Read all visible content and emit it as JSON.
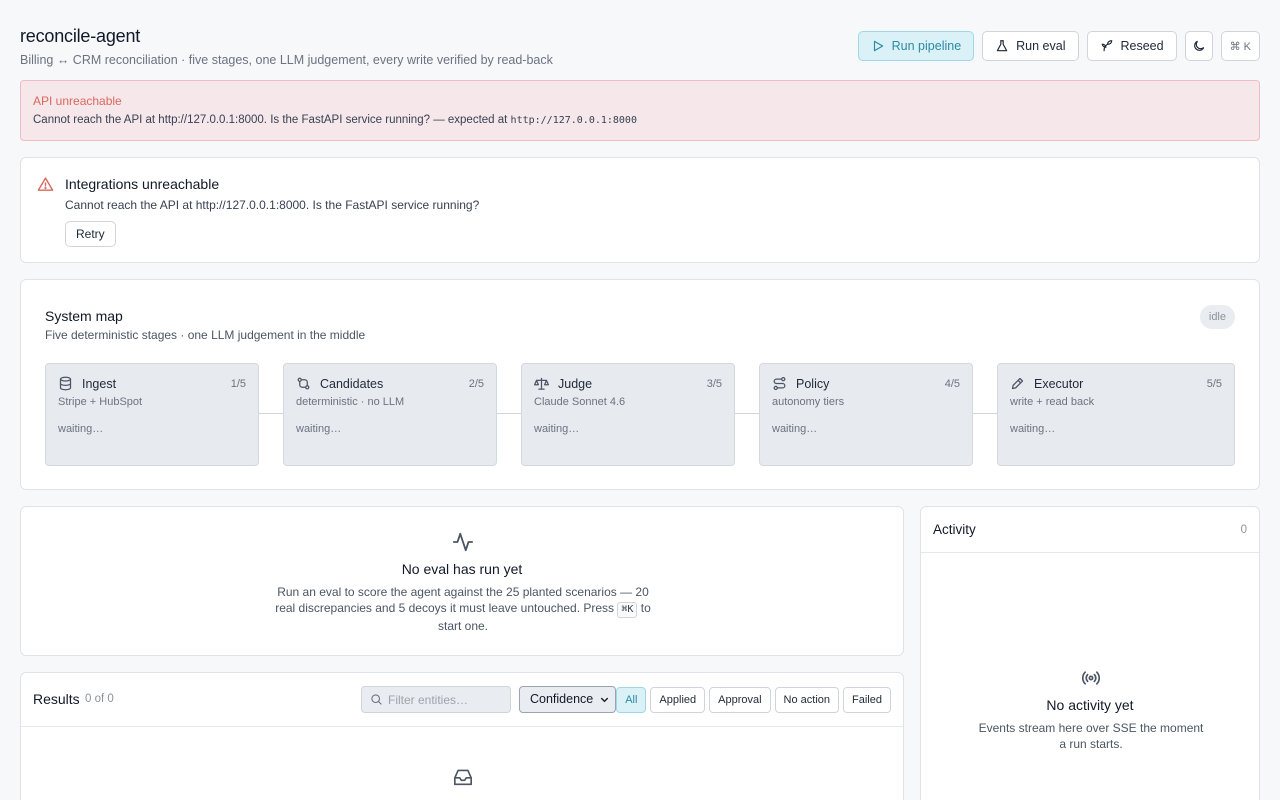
{
  "header": {
    "title": "reconcile-agent",
    "subtitle": "Billing ↔ CRM reconciliation · five stages, one LLM judgement, every write verified by read-back"
  },
  "toolbar": {
    "run_pipeline": "Run pipeline",
    "run_eval": "Run eval",
    "reseed": "Reseed",
    "kbd": "⌘ K"
  },
  "alert": {
    "title": "API unreachable",
    "message": "Cannot reach the API at http://127.0.0.1:8000. Is the FastAPI service running? — expected at ",
    "expected_url": "http://127.0.0.1:8000"
  },
  "integrations": {
    "title": "Integrations unreachable",
    "message": "Cannot reach the API at http://127.0.0.1:8000. Is the FastAPI service running?",
    "retry": "Retry"
  },
  "system_map": {
    "title": "System map",
    "subtitle": "Five deterministic stages · one LLM judgement in the middle",
    "status": "idle",
    "stages": [
      {
        "name": "Ingest",
        "step": "1/5",
        "desc": "Stripe + HubSpot",
        "status": "waiting…",
        "icon": "database-icon"
      },
      {
        "name": "Candidates",
        "step": "2/5",
        "desc": "deterministic · no LLM",
        "status": "waiting…",
        "icon": "git-compare-icon"
      },
      {
        "name": "Judge",
        "step": "3/5",
        "desc": "Claude Sonnet 4.6",
        "status": "waiting…",
        "icon": "scale-icon"
      },
      {
        "name": "Policy",
        "step": "4/5",
        "desc": "autonomy tiers",
        "status": "waiting…",
        "icon": "route-icon"
      },
      {
        "name": "Executor",
        "step": "5/5",
        "desc": "write + read back",
        "status": "waiting…",
        "icon": "pencil-icon"
      }
    ]
  },
  "eval": {
    "title": "No eval has run yet",
    "desc_before": "Run an eval to score the agent against the 25 planted scenarios — 20 real discrepancies and 5 decoys it must leave untouched. Press ",
    "kbd": "⌘K",
    "desc_after": " to start one."
  },
  "results": {
    "title": "Results",
    "count": "0 of 0",
    "search_placeholder": "Filter entities…",
    "sort": "Confidence",
    "filters": [
      "All",
      "Applied",
      "Approval",
      "No action",
      "Failed"
    ],
    "active_filter": "All"
  },
  "activity": {
    "title": "Activity",
    "count": "0",
    "empty_title": "No activity yet",
    "empty_desc": "Events stream here over SSE the moment a run starts."
  },
  "colors": {
    "accent": "#2d8aa3",
    "accent_bg": "#d9f1f7",
    "error": "#d9685f",
    "error_bg": "#f6e7ea"
  }
}
